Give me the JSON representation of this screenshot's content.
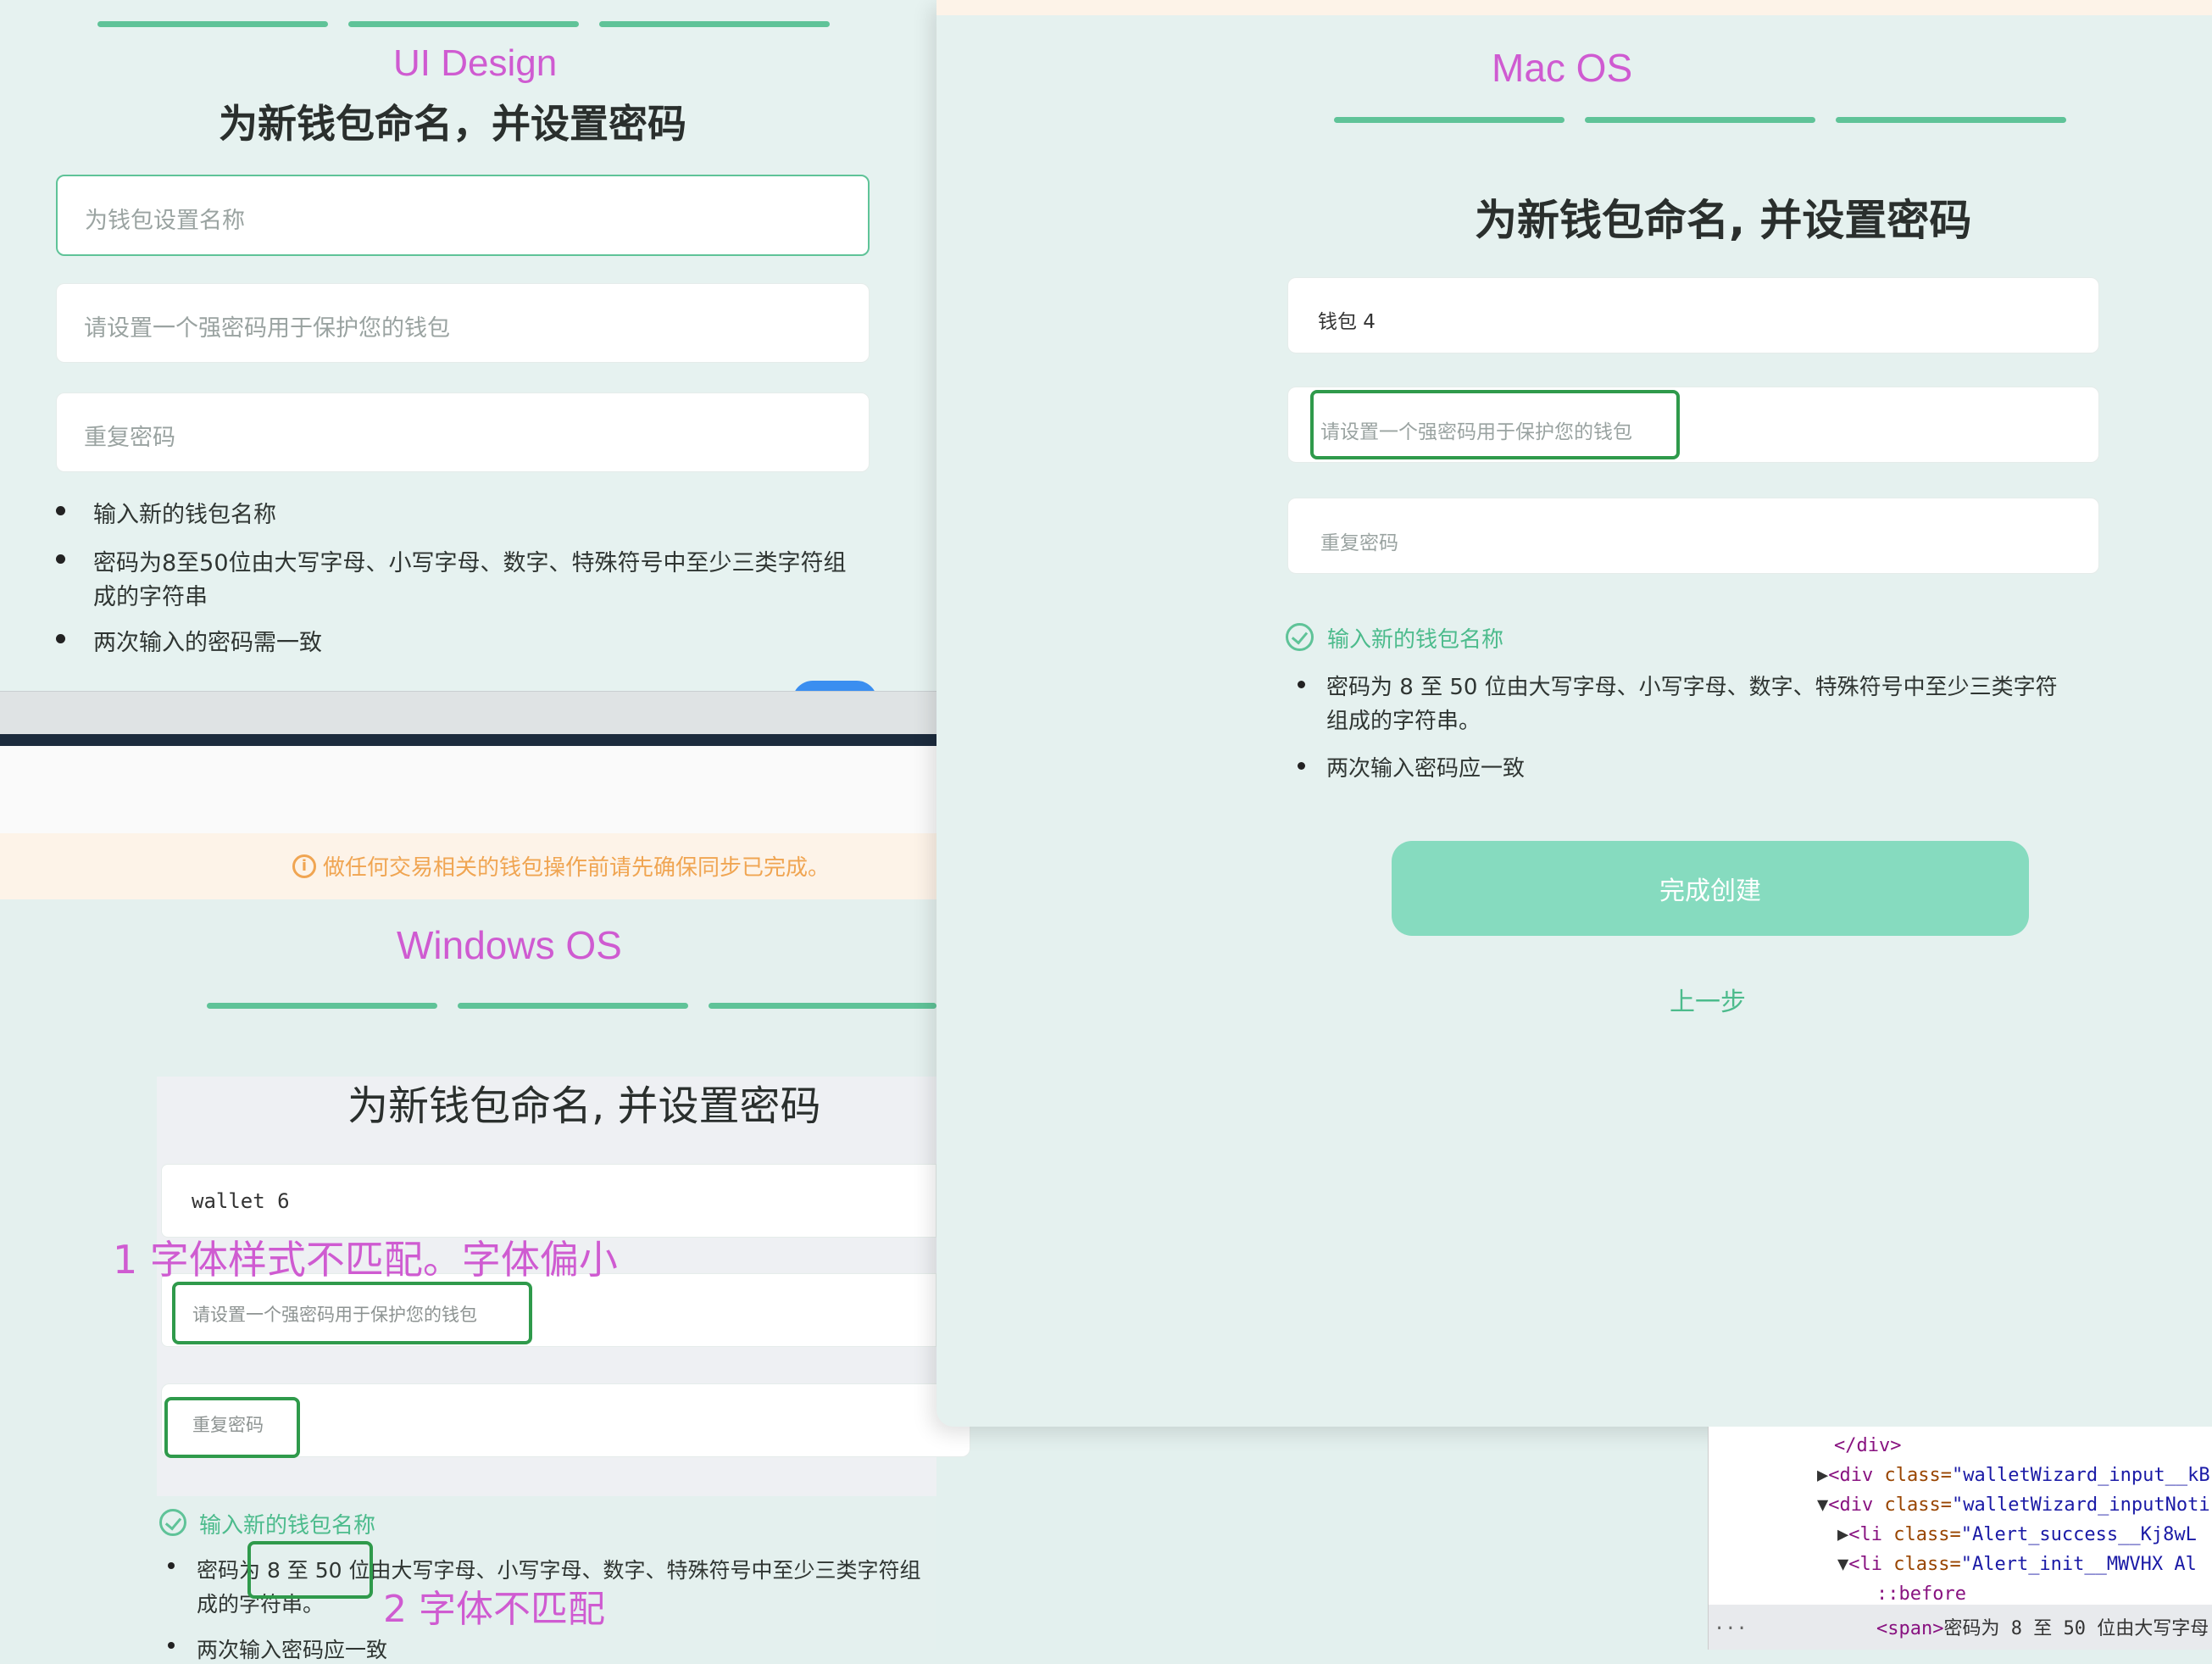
{
  "ui_design": {
    "label": "UI Design",
    "heading": "为新钱包命名，并设置密码",
    "name_placeholder": "为钱包设置名称",
    "password_placeholder": "请设置一个强密码用于保护您的钱包",
    "repeat_placeholder": "重复密码",
    "rules": [
      "输入新的钱包名称",
      "密码为8至50位由大写字母、小写字母、数字、特殊符号中至少三类字符组",
      "成的字符串",
      "两次输入的密码需一致"
    ]
  },
  "windows_os": {
    "alert": "做任何交易相关的钱包操作前请先确保同步已完成。",
    "label": "Windows OS",
    "heading": "为新钱包命名, 并设置密码",
    "name_value": "wallet 6",
    "password_placeholder": "请设置一个强密码用于保护您的钱包",
    "repeat_placeholder": "重复密码",
    "rule_success": "输入新的钱包名称",
    "rule_2_line1": "密码为 8 至 50 位由大写字母、小写字母、数字、特殊符号中至少三类字符组",
    "rule_2_line2": "成的字符串。",
    "rule_3": "两次输入密码应一致"
  },
  "mac_os": {
    "label": "Mac OS",
    "heading": "为新钱包命名, 并设置密码",
    "name_value": "钱包 4",
    "password_placeholder": "请设置一个强密码用于保护您的钱包",
    "repeat_placeholder": "重复密码",
    "rule_success": "输入新的钱包名称",
    "rule_2_line1": "密码为 8 至 50 位由大写字母、小写字母、数字、特殊符号中至少三类字符",
    "rule_2_line2": "组成的字符串。",
    "rule_3": "两次输入密码应一致",
    "primary_button": "完成创建",
    "back_link": "上一步"
  },
  "annotations": {
    "note_1": "1 字体样式不匹配。字体偏小",
    "note_2": "2 字体不匹配"
  },
  "devtools": {
    "lines": [
      {
        "indent": 0,
        "text": "</div>"
      },
      {
        "indent": 0,
        "prefix": "▶",
        "tag": "<div ",
        "attr": "class=",
        "val": "\"walletWizard_input__kB"
      },
      {
        "indent": 0,
        "prefix": "▼",
        "tag": "<div ",
        "attr": "class=",
        "val": "\"walletWizard_inputNoti"
      },
      {
        "indent": 1,
        "prefix": "▶",
        "tag": "<li ",
        "attr": "class=",
        "val": "\"Alert_success__Kj8wL"
      },
      {
        "indent": 1,
        "prefix": "▼",
        "tag": "<li ",
        "attr": "class=",
        "val": "\"Alert_init__MWVHX  Al"
      },
      {
        "indent": 2,
        "text": "::before"
      },
      {
        "indent": 2,
        "tag": "<span>",
        "text2": "密码为 8 至 50 位由大写字母"
      }
    ],
    "ellipsis": "..."
  },
  "colors": {
    "brand_green": "#5fc398",
    "button_green": "#86dbbf",
    "annotation_magenta": "#cf5bd1",
    "annotation_box_green": "#2f9a4b",
    "alert_orange": "#f0a552"
  },
  "icons": [
    "info-icon",
    "check-circle-icon"
  ]
}
